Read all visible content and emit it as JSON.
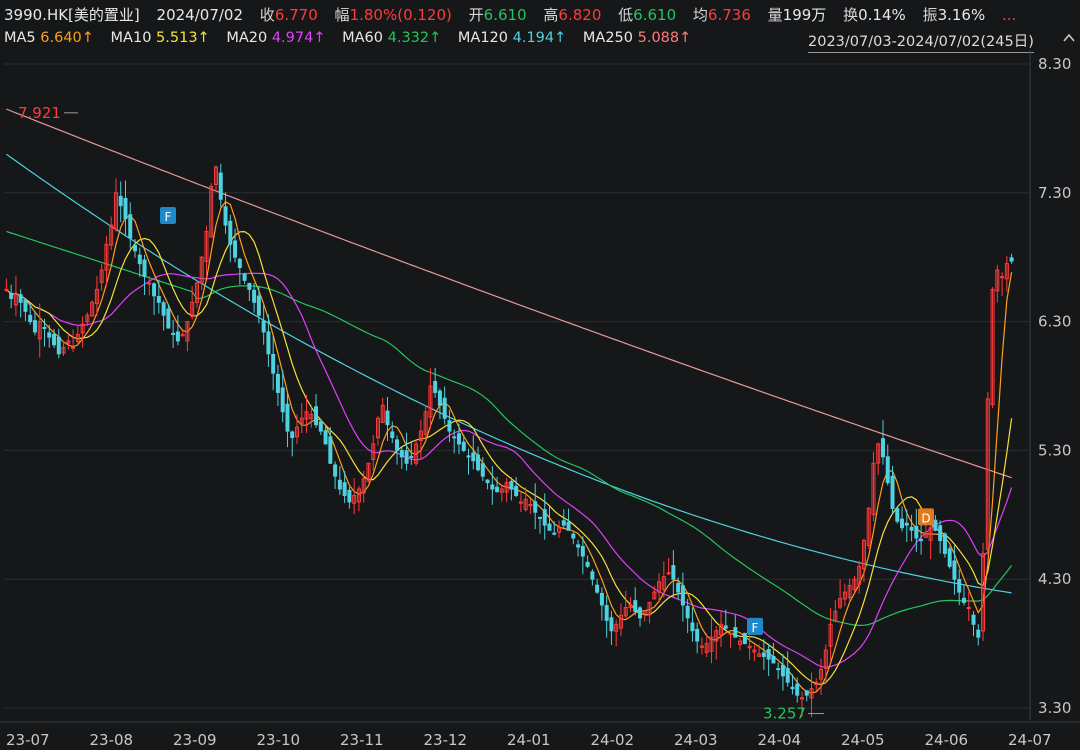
{
  "header": {
    "code_name": "3990.HK[美的置业]",
    "date": "2024/07/02",
    "close_label": "收",
    "close": "6.770",
    "change_label": "幅",
    "change": "1.80%(0.120)",
    "open_label": "开",
    "open": "6.610",
    "high_label": "高",
    "high": "6.820",
    "low_label": "低",
    "low": "6.610",
    "avg_label": "均",
    "avg": "6.736",
    "volume_label": "量",
    "volume": "199万",
    "turnover_label": "换",
    "turnover": "0.14%",
    "amplitude_label": "振",
    "amplitude": "3.16%",
    "more": "..."
  },
  "ma_legend": [
    {
      "label": "MA5",
      "value": "6.640↑",
      "color": "#ff9f1c"
    },
    {
      "label": "MA10",
      "value": "5.513↑",
      "color": "#f5e13a"
    },
    {
      "label": "MA20",
      "value": "4.974↑",
      "color": "#e040fb"
    },
    {
      "label": "MA60",
      "value": "4.332↑",
      "color": "#22c55e"
    },
    {
      "label": "MA120",
      "value": "4.194↑",
      "color": "#4fd1e0"
    },
    {
      "label": "MA250",
      "value": "5.088↑",
      "color": "#ff7b7b"
    }
  ],
  "range_label": "2023/07/03-2024/07/02(245日)",
  "colors": {
    "up": "#ff3b3b",
    "down": "#22c55e",
    "down_candle": "#4fd1e0",
    "bg": "#161719"
  },
  "chart_data": {
    "type": "candlestick",
    "y_ticks": [
      "8.30",
      "7.30",
      "6.30",
      "5.30",
      "4.30",
      "3.30"
    ],
    "ylim": [
      3.3,
      8.3
    ],
    "x_ticks": [
      "23-07",
      "23-08",
      "23-09",
      "23-10",
      "23-11",
      "23-12",
      "24-01",
      "24-02",
      "24-03",
      "24-04",
      "24-05",
      "24-06",
      "24-07"
    ],
    "annotations": {
      "max_label": "7.921",
      "max_value": 7.921,
      "min_label": "3.257",
      "min_value": 3.257,
      "markers": [
        {
          "text": "F",
          "month": "23-09",
          "value": 7.12,
          "color": "#1e88c8"
        },
        {
          "text": "F",
          "month": "24-04",
          "value": 3.93,
          "color": "#1e88c8"
        },
        {
          "text": "D",
          "month": "24-05",
          "value": 4.78,
          "color": "#e07b1c"
        }
      ]
    },
    "closes": [
      6.55,
      6.48,
      6.52,
      6.45,
      6.38,
      6.3,
      6.22,
      6.3,
      6.25,
      6.18,
      6.12,
      6.05,
      6.1,
      6.15,
      6.1,
      6.2,
      6.28,
      6.35,
      6.45,
      6.55,
      6.7,
      6.9,
      7.05,
      7.3,
      7.2,
      7.1,
      6.95,
      6.85,
      6.75,
      6.65,
      6.6,
      6.5,
      6.45,
      6.35,
      6.25,
      6.2,
      6.15,
      6.2,
      6.3,
      6.45,
      6.6,
      6.8,
      7.0,
      7.35,
      7.5,
      7.25,
      7.05,
      6.9,
      6.8,
      6.72,
      6.62,
      6.55,
      6.45,
      6.35,
      6.22,
      6.05,
      5.9,
      5.75,
      5.6,
      5.45,
      5.4,
      5.48,
      5.55,
      5.6,
      5.58,
      5.5,
      5.45,
      5.35,
      5.2,
      5.1,
      5.0,
      4.95,
      4.9,
      4.95,
      5.0,
      5.08,
      5.2,
      5.35,
      5.55,
      5.65,
      5.5,
      5.4,
      5.3,
      5.25,
      5.2,
      5.25,
      5.35,
      5.45,
      5.6,
      5.8,
      5.75,
      5.65,
      5.55,
      5.45,
      5.4,
      5.35,
      5.3,
      5.25,
      5.22,
      5.15,
      5.1,
      5.05,
      5.0,
      4.98,
      5.0,
      5.05,
      5.0,
      4.95,
      4.9,
      4.92,
      4.88,
      4.82,
      4.78,
      4.72,
      4.68,
      4.65,
      4.7,
      4.72,
      4.68,
      4.62,
      4.55,
      4.48,
      4.4,
      4.3,
      4.2,
      4.1,
      3.98,
      3.9,
      3.95,
      4.02,
      4.08,
      4.1,
      4.05,
      4.0,
      4.05,
      4.12,
      4.2,
      4.28,
      4.32,
      4.35,
      4.3,
      4.2,
      4.1,
      4.0,
      3.9,
      3.82,
      3.78,
      3.8,
      3.85,
      3.9,
      3.95,
      3.92,
      3.88,
      3.85,
      3.82,
      3.8,
      3.78,
      3.75,
      3.72,
      3.7,
      3.68,
      3.65,
      3.6,
      3.55,
      3.5,
      3.45,
      3.4,
      3.38,
      3.4,
      3.45,
      3.5,
      3.6,
      3.75,
      3.95,
      4.05,
      4.15,
      4.2,
      4.25,
      4.3,
      4.4,
      4.6,
      4.85,
      5.2,
      5.35,
      5.25,
      5.05,
      4.85,
      4.75,
      4.7,
      4.72,
      4.68,
      4.62,
      4.6,
      4.65,
      4.7,
      4.68,
      4.6,
      4.5,
      4.4,
      4.3,
      4.2,
      4.12,
      4.08,
      3.95,
      3.85,
      4.5,
      5.7,
      6.55,
      6.7,
      6.65,
      6.75,
      6.77
    ],
    "ma5_end": 6.64,
    "ma10_end": 5.513,
    "ma20_end": 4.974,
    "ma60_end": 4.332,
    "ma120_end": 4.194,
    "ma250_end": 5.088
  }
}
